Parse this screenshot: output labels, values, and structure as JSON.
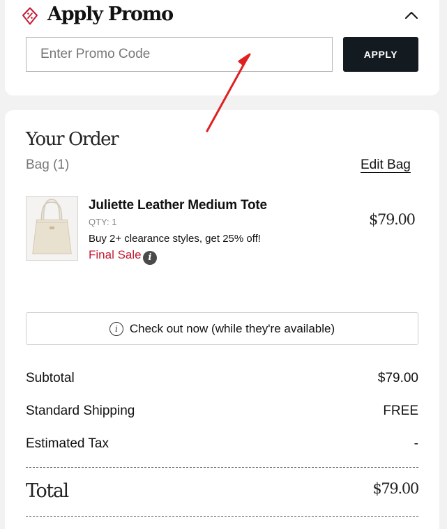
{
  "promo": {
    "title": "Apply Promo",
    "icon": "promo-tag-icon",
    "input_value": "",
    "placeholder": "Enter Promo Code",
    "apply_label": "APPLY",
    "expanded": true
  },
  "order": {
    "title": "Your Order",
    "bag_count": "Bag (1)",
    "edit_bag_label": "Edit Bag",
    "items": [
      {
        "name": "Juliette Leather Medium Tote",
        "qty": "QTY: 1",
        "promo_text": "Buy 2+ clearance styles, get 25% off!",
        "sale_label": "Final Sale",
        "price": "$79.00",
        "image": "beige-tote-bag"
      }
    ],
    "checkout_note": "Check out now (while they're available)"
  },
  "summary": {
    "rows": [
      {
        "label": "Subtotal",
        "value": "$79.00"
      },
      {
        "label": "Standard Shipping",
        "value": "FREE"
      },
      {
        "label": "Estimated Tax",
        "value": "-"
      }
    ],
    "total_label": "Total",
    "total_value": "$79.00"
  },
  "colors": {
    "brand_red": "#c41a35",
    "apply_button": "#131a20",
    "annotation_arrow": "#e02020",
    "page_background": "#f2f2f2"
  }
}
